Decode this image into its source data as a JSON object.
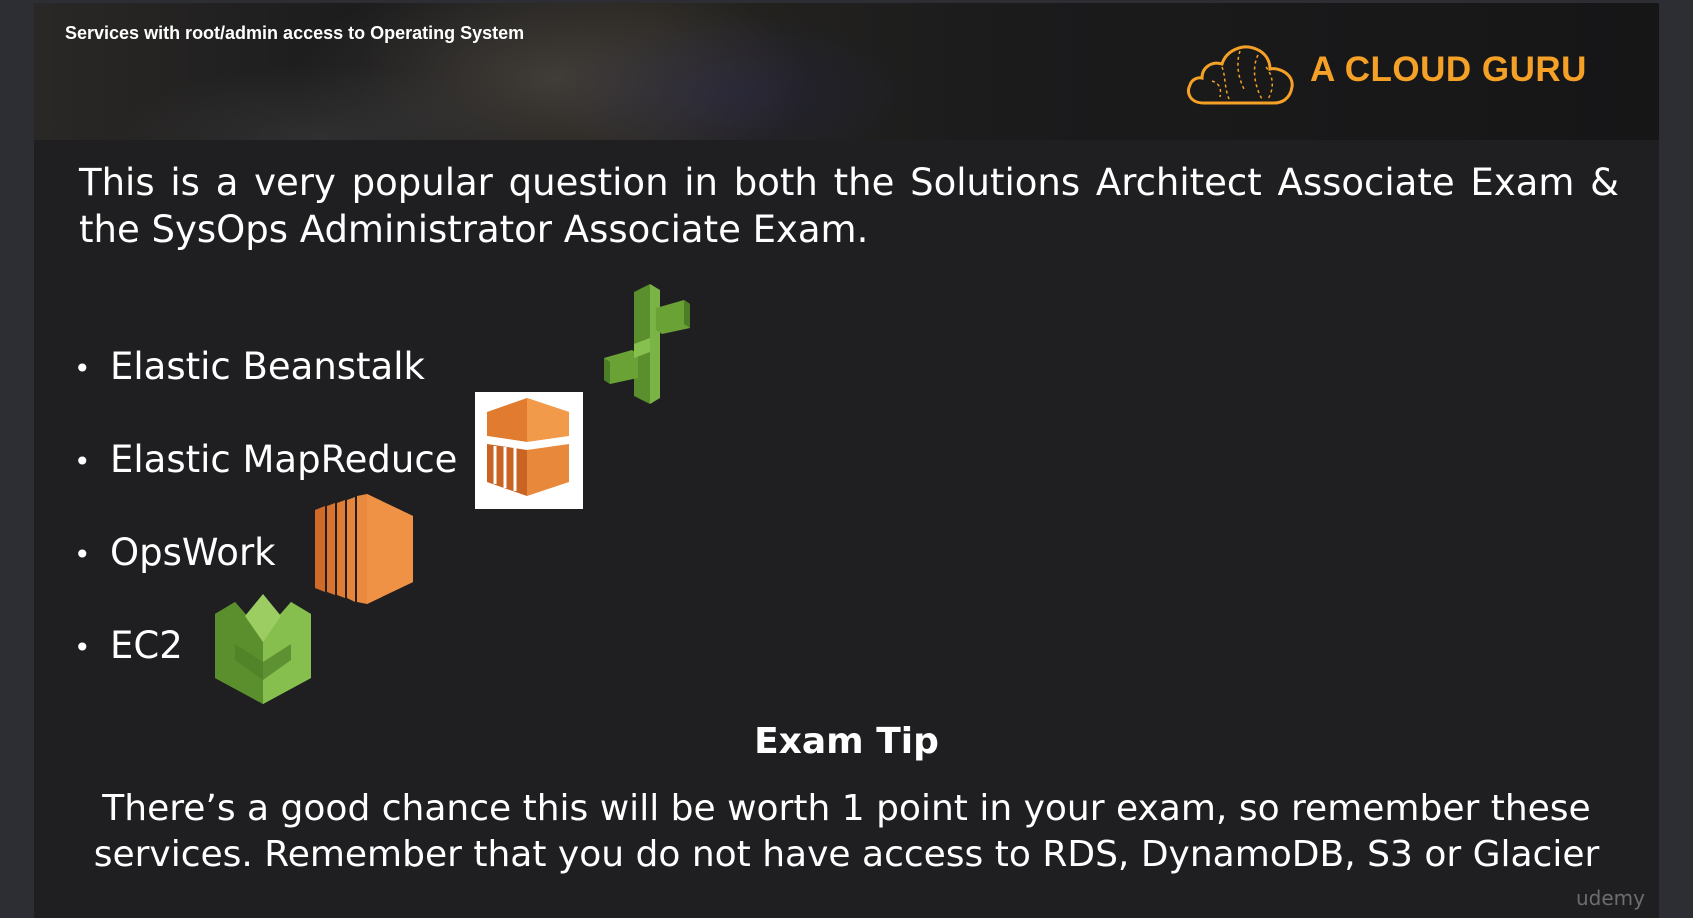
{
  "header": {
    "title": "Services with root/admin access to Operating System",
    "logo_text": "A CLOUD GURU"
  },
  "intro_text": "This is a very popular question in both the Solutions Architect Associate Exam & the SysOps Administrator Associate Exam.",
  "bullets": [
    {
      "label": "Elastic Beanstalk",
      "icon": "elastic-beanstalk-icon"
    },
    {
      "label": "Elastic MapReduce",
      "icon": "elastic-mapreduce-icon"
    },
    {
      "label": "OpsWork",
      "icon": "opsworks-icon"
    },
    {
      "label": "EC2",
      "icon": "ec2-icon"
    }
  ],
  "tip": {
    "title": "Exam Tip",
    "line1": "There’s a good chance this will be worth 1 point in your exam, so remember these",
    "line2": "services. Remember that you do not have access to RDS, DynamoDB, S3 or Glacier"
  },
  "watermark": "udemy",
  "colors": {
    "slide_bg": "#1f1f21",
    "text": "#ffffff",
    "brand_orange": "#f5a027",
    "aws_green": "#6aa235",
    "aws_orange": "#e8803a"
  }
}
